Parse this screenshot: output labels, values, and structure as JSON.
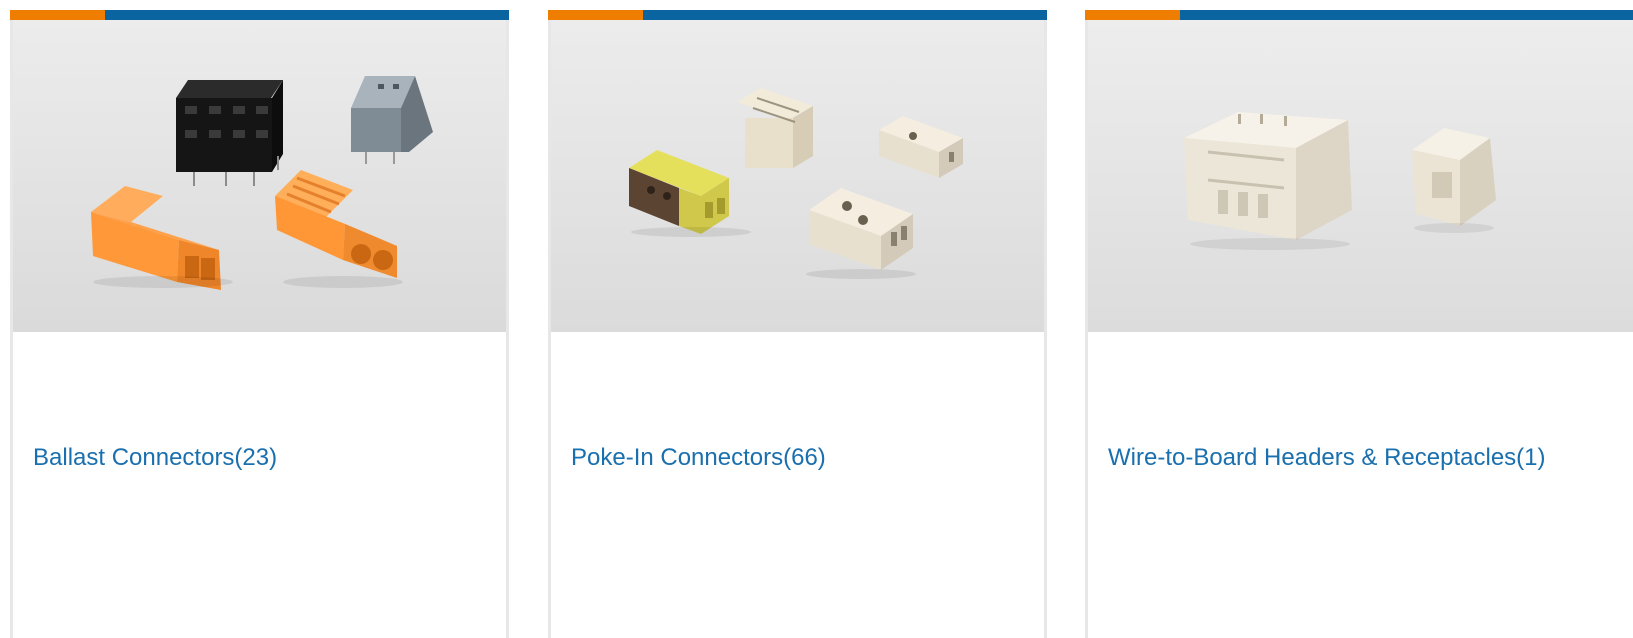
{
  "colors": {
    "accent": "#ef7d00",
    "brand": "#0a64a0",
    "link": "#1a6fae",
    "card_border": "#e7e7e7",
    "photo_bg": "#e3e3e3"
  },
  "cards": [
    {
      "title": "Ballast Connectors(23)",
      "image": "ballast-connectors-photo"
    },
    {
      "title": "Poke-In Connectors(66)",
      "image": "poke-in-connectors-photo"
    },
    {
      "title": "Wire-to-Board Headers & Receptacles(1)",
      "image": "wire-to-board-headers-photo"
    }
  ]
}
